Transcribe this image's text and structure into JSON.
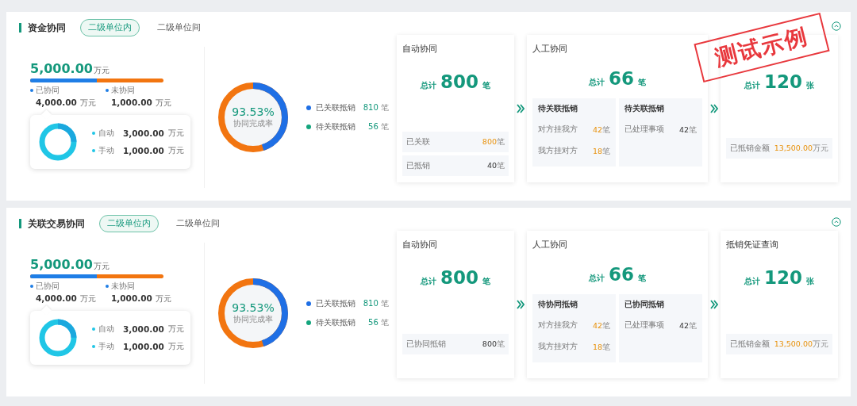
{
  "panels": [
    {
      "title": "资金协同",
      "tabs": [
        {
          "label": "二级单位内",
          "selected": true
        },
        {
          "label": "二级单位间",
          "selected": false
        }
      ],
      "total": {
        "value": "5,000.00",
        "unit": "万元"
      },
      "progress": {
        "level": 0.5
      },
      "split": [
        {
          "label": "已协同",
          "value": "4,000.00",
          "unit": "万元"
        },
        {
          "label": "未协同",
          "value": "1,000.00",
          "unit": "万元"
        }
      ],
      "popup": [
        {
          "label": "自动",
          "value": "3,000.00",
          "unit": "万元"
        },
        {
          "label": "手动",
          "value": "1,000.00",
          "unit": "万元"
        }
      ],
      "rate": {
        "value": "93.53%",
        "label": "协同完成率",
        "level": 0.45
      },
      "rate_legend": [
        {
          "label": "已关联抵销",
          "value": "810",
          "unit": "笔",
          "color": "#1f6fe5"
        },
        {
          "label": "待关联抵销",
          "value": "56",
          "unit": "笔",
          "color": "#14a57d"
        }
      ],
      "cards": [
        {
          "kind": "simple",
          "title": "自动协同",
          "total_label": "总计",
          "total": "800",
          "unit": "笔",
          "rows": [
            {
              "label": "已关联",
              "value": "800",
              "unit": "笔",
              "highlight": true
            },
            {
              "label": "已抵销",
              "value": "40",
              "unit": "笔",
              "highlight": false
            }
          ]
        },
        {
          "kind": "grouped",
          "title": "人工协同",
          "total_label": "总计",
          "total": "66",
          "unit": "笔",
          "groups": [
            {
              "title": "待关联抵销",
              "rows": [
                {
                  "label": "对方挂我方",
                  "value": "42",
                  "unit": "笔",
                  "highlight": true
                },
                {
                  "label": "我方挂对方",
                  "value": "18",
                  "unit": "笔",
                  "highlight": true
                }
              ]
            },
            {
              "title": "待关联抵销",
              "rows": [
                {
                  "label": "已处理事项",
                  "value": "42",
                  "unit": "笔",
                  "highlight": false
                }
              ]
            }
          ]
        },
        {
          "kind": "simple",
          "total_label": "总计",
          "total": "120",
          "unit": "张",
          "rows": [
            {
              "label": "已抵销金额",
              "value": "13,500.00",
              "unit": "万元",
              "highlight": true
            }
          ]
        }
      ],
      "stamp": "测试示例"
    },
    {
      "title": "关联交易协同",
      "tabs": [
        {
          "label": "二级单位内",
          "selected": true
        },
        {
          "label": "二级单位间",
          "selected": false
        }
      ],
      "total": {
        "value": "5,000.00",
        "unit": "万元"
      },
      "progress": {
        "level": 0.5
      },
      "split": [
        {
          "label": "已协同",
          "value": "4,000.00",
          "unit": "万元"
        },
        {
          "label": "未协同",
          "value": "1,000.00",
          "unit": "万元"
        }
      ],
      "popup": [
        {
          "label": "自动",
          "value": "3,000.00",
          "unit": "万元"
        },
        {
          "label": "手动",
          "value": "1,000.00",
          "unit": "万元"
        }
      ],
      "rate": {
        "value": "93.53%",
        "label": "协同完成率",
        "level": 0.45
      },
      "rate_legend": [
        {
          "label": "已关联抵销",
          "value": "810",
          "unit": "笔",
          "color": "#1f6fe5"
        },
        {
          "label": "待关联抵销",
          "value": "56",
          "unit": "笔",
          "color": "#14a57d"
        }
      ],
      "cards": [
        {
          "kind": "simple",
          "title": "自动协同",
          "total_label": "总计",
          "total": "800",
          "unit": "笔",
          "rows": [
            {
              "label": "已协同抵销",
              "value": "800",
              "unit": "笔",
              "highlight": false
            }
          ]
        },
        {
          "kind": "grouped",
          "title": "人工协同",
          "total_label": "总计",
          "total": "66",
          "unit": "笔",
          "groups": [
            {
              "title": "待协同抵销",
              "rows": [
                {
                  "label": "对方挂我方",
                  "value": "42",
                  "unit": "笔",
                  "highlight": true
                },
                {
                  "label": "我方挂对方",
                  "value": "18",
                  "unit": "笔",
                  "highlight": true
                }
              ]
            },
            {
              "title": "已协同抵销",
              "rows": [
                {
                  "label": "已处理事项",
                  "value": "42",
                  "unit": "笔",
                  "highlight": false
                }
              ]
            }
          ]
        },
        {
          "kind": "simple",
          "title": "抵销凭证查询",
          "total_label": "总计",
          "total": "120",
          "unit": "张",
          "rows": [
            {
              "label": "已抵销金额",
              "value": "13,500.00",
              "unit": "万元",
              "highlight": true
            }
          ]
        }
      ]
    }
  ]
}
